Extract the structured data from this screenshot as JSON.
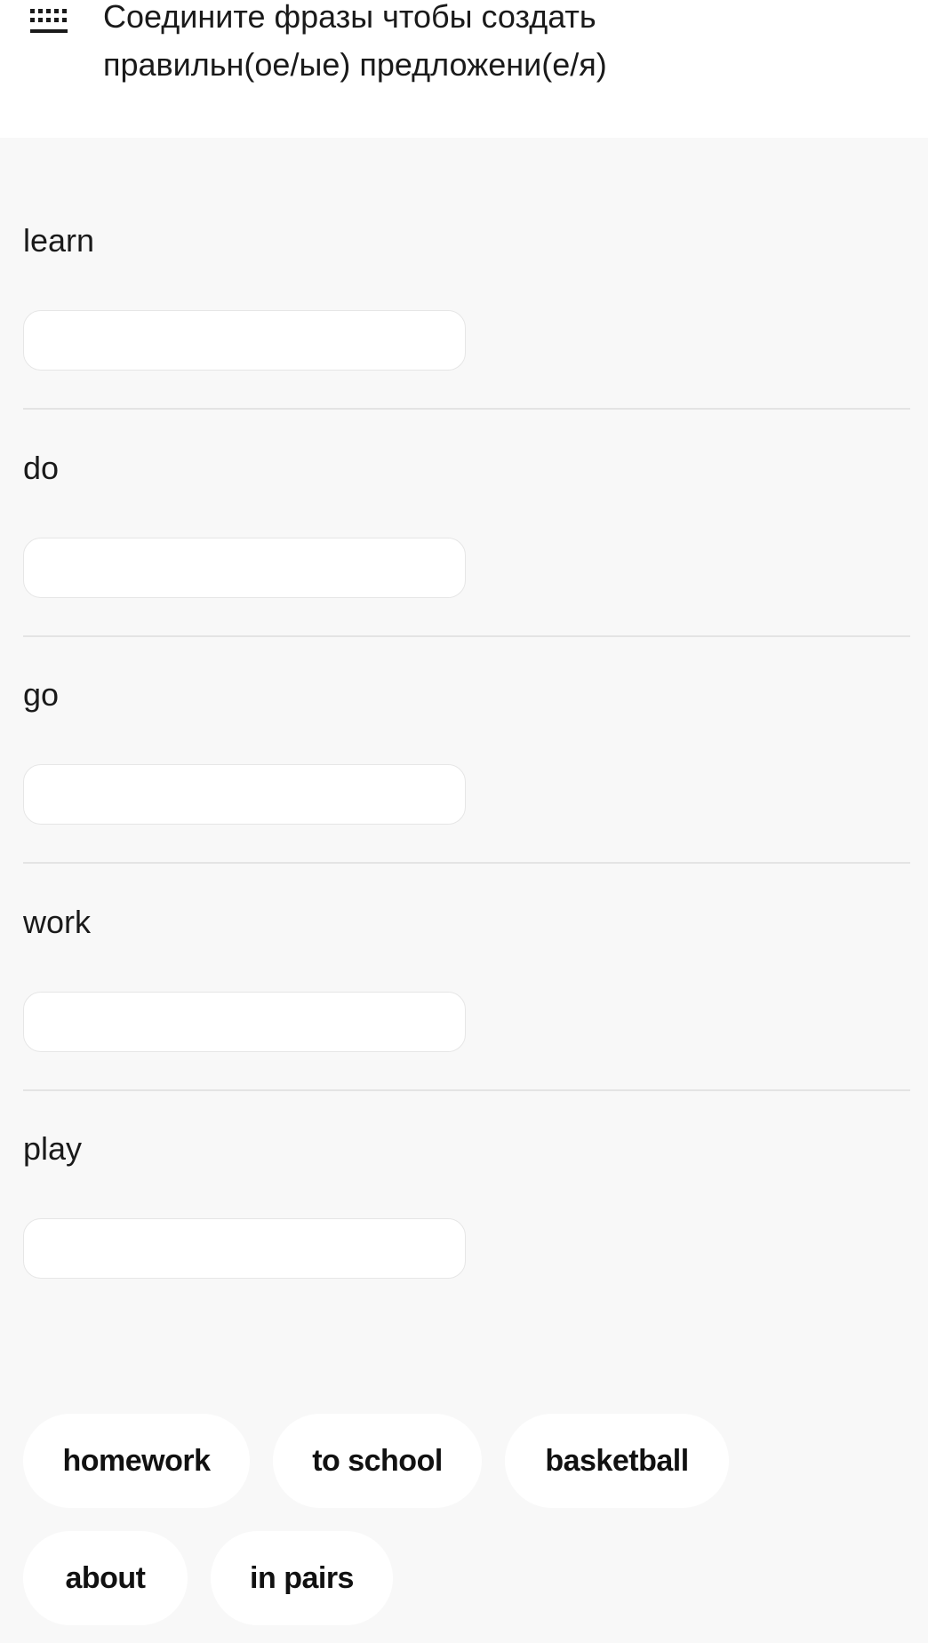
{
  "header": {
    "icon": "keypad-icon",
    "instruction_line1": "Соедините фразы чтобы создать",
    "instruction_line2": "правильн(ое/ые) предложени(е/я)"
  },
  "rows": [
    {
      "label": "learn"
    },
    {
      "label": "do"
    },
    {
      "label": "go"
    },
    {
      "label": "work"
    },
    {
      "label": "play"
    }
  ],
  "options": [
    {
      "label": "homework"
    },
    {
      "label": "to school"
    },
    {
      "label": "basketball"
    },
    {
      "label": "about"
    },
    {
      "label": "in pairs"
    }
  ]
}
